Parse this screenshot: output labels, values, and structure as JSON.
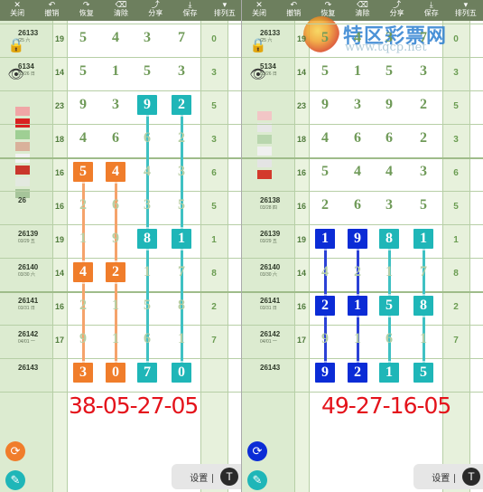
{
  "toolbar": {
    "items": [
      {
        "label": "关闭",
        "icon": "✕"
      },
      {
        "label": "撤销",
        "icon": "↶"
      },
      {
        "label": "恢复",
        "icon": "↷"
      },
      {
        "label": "清除",
        "icon": "⌫"
      },
      {
        "label": "分享",
        "icon": "⤴"
      },
      {
        "label": "保存",
        "icon": "⤓"
      },
      {
        "label": "排列五",
        "icon": "▾"
      }
    ]
  },
  "periods": [
    {
      "num": "26133",
      "date": "/25 六"
    },
    {
      "num": "6134",
      "date": "03/26 日"
    },
    {
      "num": "",
      "date": ""
    },
    {
      "num": "",
      "date": ""
    },
    {
      "num": "",
      "date": ""
    },
    {
      "num": "26",
      "date": ""
    },
    {
      "num": "26139",
      "date": "03/29 五"
    },
    {
      "num": "26140",
      "date": "03/30 六"
    },
    {
      "num": "26141",
      "date": "03/31 日"
    },
    {
      "num": "26142",
      "date": "04/01 一"
    },
    {
      "num": "26143",
      "date": ""
    }
  ],
  "periods_right": [
    {
      "num": "26133",
      "date": "/25 六"
    },
    {
      "num": "5134",
      "date": "03/26 日"
    },
    {
      "num": "",
      "date": ""
    },
    {
      "num": "",
      "date": ""
    },
    {
      "num": "",
      "date": ""
    },
    {
      "num": "26138",
      "date": "03/28 四"
    },
    {
      "num": "26139",
      "date": "03/29 五"
    },
    {
      "num": "26140",
      "date": "03/30 六"
    },
    {
      "num": "26141",
      "date": "03/31 日"
    },
    {
      "num": "26142",
      "date": "04/01 一"
    },
    {
      "num": "26143",
      "date": ""
    }
  ],
  "row_numbers": [
    "19",
    "14",
    "23",
    "18",
    "16",
    "16",
    "19",
    "14",
    "16",
    "17",
    ""
  ],
  "right_numbers": [
    "0",
    "3",
    "5",
    "3",
    "6",
    "5",
    "1",
    "8",
    "2",
    "7",
    ""
  ],
  "left_grid": [
    [
      "5",
      "4",
      "3",
      "7"
    ],
    [
      "5",
      "1",
      "5",
      "3"
    ],
    [
      "9",
      "3",
      "9",
      "2"
    ],
    [
      "4",
      "6",
      "6",
      "2"
    ],
    [
      "5",
      "4",
      "4",
      "3"
    ],
    [
      "2",
      "6",
      "3",
      "5"
    ],
    [
      "1",
      "9",
      "8",
      "1"
    ],
    [
      "4",
      "2",
      "1",
      "7"
    ],
    [
      "2",
      "1",
      "5",
      "8"
    ],
    [
      "9",
      "1",
      "6",
      "1"
    ],
    [
      "3",
      "0",
      "7",
      "0"
    ]
  ],
  "right_grid": [
    [
      "5",
      "4",
      "3",
      "7"
    ],
    [
      "5",
      "1",
      "5",
      "3"
    ],
    [
      "9",
      "3",
      "9",
      "2"
    ],
    [
      "4",
      "6",
      "6",
      "2"
    ],
    [
      "5",
      "4",
      "4",
      "3"
    ],
    [
      "2",
      "6",
      "3",
      "5"
    ],
    [
      "1",
      "9",
      "8",
      "1"
    ],
    [
      "4",
      "2",
      "1",
      "7"
    ],
    [
      "2",
      "1",
      "5",
      "8"
    ],
    [
      "9",
      "1",
      "6",
      "1"
    ],
    [
      "9",
      "2",
      "1",
      "5"
    ]
  ],
  "left_result": "38-05-27-05",
  "right_result": "49-27-16-05",
  "settings_label": "设置 ∣",
  "settings_glyph": "T",
  "watermark": {
    "title": "特区彩票网",
    "url": "www.tqcp.net"
  },
  "colors": {
    "orange": "#f07d2b",
    "teal": "#1fb6b8",
    "blue": "#0b2cd6",
    "result": "#e4131b"
  }
}
